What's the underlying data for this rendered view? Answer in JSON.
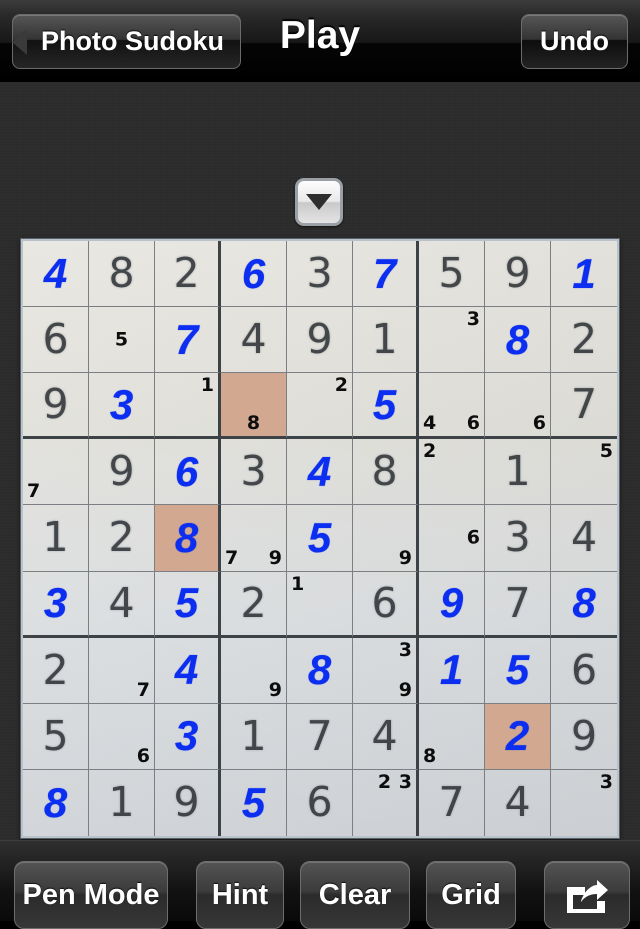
{
  "navbar": {
    "back_label": "Photo Sudoku",
    "title": "Play",
    "undo_label": "Undo"
  },
  "dropdown": {
    "icon": "chevron-down-icon"
  },
  "toolbar": {
    "pen_mode_label": "Pen Mode",
    "hint_label": "Hint",
    "clear_label": "Clear",
    "grid_label": "Grid",
    "share_icon": "share-arrow-icon"
  },
  "colors": {
    "user_entry": "#0b2ef0",
    "given_entry": "#2e3236",
    "highlight_cell": "#d2a890",
    "board_background": "#e3e2dc",
    "chrome": "#2b2b2b"
  },
  "board": {
    "rows": 9,
    "columns": 9,
    "cells": [
      [
        {
          "value": "4",
          "type": "user"
        },
        {
          "value": "8",
          "type": "given"
        },
        {
          "value": "2",
          "type": "given"
        },
        {
          "value": "6",
          "type": "user"
        },
        {
          "value": "3",
          "type": "given"
        },
        {
          "value": "7",
          "type": "user"
        },
        {
          "value": "5",
          "type": "given"
        },
        {
          "value": "9",
          "type": "given"
        },
        {
          "value": "1",
          "type": "user"
        }
      ],
      [
        {
          "value": "6",
          "type": "given"
        },
        {
          "value": "",
          "type": "empty",
          "marks": [
            {
              "text": "5",
              "pos": "mc"
            }
          ]
        },
        {
          "value": "7",
          "type": "user"
        },
        {
          "value": "4",
          "type": "given"
        },
        {
          "value": "9",
          "type": "given"
        },
        {
          "value": "1",
          "type": "given"
        },
        {
          "value": "",
          "type": "empty",
          "marks": [
            {
              "text": "3",
              "pos": "tr"
            }
          ]
        },
        {
          "value": "8",
          "type": "user"
        },
        {
          "value": "2",
          "type": "given"
        }
      ],
      [
        {
          "value": "9",
          "type": "given"
        },
        {
          "value": "3",
          "type": "user"
        },
        {
          "value": "",
          "type": "empty",
          "marks": [
            {
              "text": "1",
              "pos": "tr"
            }
          ]
        },
        {
          "value": "",
          "type": "empty",
          "highlight": true,
          "marks": [
            {
              "text": "8",
              "pos": "bc"
            }
          ]
        },
        {
          "value": "",
          "type": "empty",
          "marks": [
            {
              "text": "2",
              "pos": "tr"
            }
          ]
        },
        {
          "value": "5",
          "type": "user"
        },
        {
          "value": "",
          "type": "empty",
          "marks": [
            {
              "text": "4",
              "pos": "bl"
            },
            {
              "text": "6",
              "pos": "br"
            }
          ]
        },
        {
          "value": "",
          "type": "empty",
          "marks": [
            {
              "text": "6",
              "pos": "br"
            }
          ]
        },
        {
          "value": "7",
          "type": "given"
        }
      ],
      [
        {
          "value": "",
          "type": "empty",
          "marks": [
            {
              "text": "7",
              "pos": "bl"
            }
          ]
        },
        {
          "value": "9",
          "type": "given"
        },
        {
          "value": "6",
          "type": "user"
        },
        {
          "value": "3",
          "type": "given"
        },
        {
          "value": "4",
          "type": "user"
        },
        {
          "value": "8",
          "type": "given"
        },
        {
          "value": "",
          "type": "empty",
          "marks": [
            {
              "text": "2",
              "pos": "tl"
            }
          ]
        },
        {
          "value": "1",
          "type": "given"
        },
        {
          "value": "",
          "type": "empty",
          "marks": [
            {
              "text": "5",
              "pos": "tr"
            }
          ]
        }
      ],
      [
        {
          "value": "1",
          "type": "given"
        },
        {
          "value": "2",
          "type": "given"
        },
        {
          "value": "8",
          "type": "user",
          "highlight": true
        },
        {
          "value": "",
          "type": "empty",
          "marks": [
            {
              "text": "7",
              "pos": "bl"
            },
            {
              "text": "9",
              "pos": "br"
            }
          ]
        },
        {
          "value": "5",
          "type": "user"
        },
        {
          "value": "",
          "type": "empty",
          "marks": [
            {
              "text": "9",
              "pos": "br"
            }
          ]
        },
        {
          "value": "",
          "type": "empty",
          "marks": [
            {
              "text": "6",
              "pos": "mr"
            }
          ]
        },
        {
          "value": "3",
          "type": "given"
        },
        {
          "value": "4",
          "type": "given"
        }
      ],
      [
        {
          "value": "3",
          "type": "user"
        },
        {
          "value": "4",
          "type": "given"
        },
        {
          "value": "5",
          "type": "user"
        },
        {
          "value": "2",
          "type": "given"
        },
        {
          "value": "",
          "type": "empty",
          "marks": [
            {
              "text": "1",
              "pos": "tl"
            }
          ]
        },
        {
          "value": "6",
          "type": "given"
        },
        {
          "value": "9",
          "type": "user"
        },
        {
          "value": "7",
          "type": "given"
        },
        {
          "value": "8",
          "type": "user"
        }
      ],
      [
        {
          "value": "2",
          "type": "given"
        },
        {
          "value": "",
          "type": "empty",
          "marks": [
            {
              "text": "7",
              "pos": "br"
            }
          ]
        },
        {
          "value": "4",
          "type": "user"
        },
        {
          "value": "",
          "type": "empty",
          "marks": [
            {
              "text": "9",
              "pos": "br"
            }
          ]
        },
        {
          "value": "8",
          "type": "user"
        },
        {
          "value": "",
          "type": "empty",
          "marks": [
            {
              "text": "3",
              "pos": "tr"
            },
            {
              "text": "9",
              "pos": "br"
            }
          ]
        },
        {
          "value": "1",
          "type": "user"
        },
        {
          "value": "5",
          "type": "user"
        },
        {
          "value": "6",
          "type": "given"
        }
      ],
      [
        {
          "value": "5",
          "type": "given"
        },
        {
          "value": "",
          "type": "empty",
          "marks": [
            {
              "text": "6",
              "pos": "br"
            }
          ]
        },
        {
          "value": "3",
          "type": "user"
        },
        {
          "value": "1",
          "type": "given"
        },
        {
          "value": "7",
          "type": "given"
        },
        {
          "value": "4",
          "type": "given"
        },
        {
          "value": "",
          "type": "empty",
          "marks": [
            {
              "text": "8",
              "pos": "bl"
            }
          ]
        },
        {
          "value": "2",
          "type": "user",
          "highlight": true
        },
        {
          "value": "9",
          "type": "given"
        }
      ],
      [
        {
          "value": "8",
          "type": "user"
        },
        {
          "value": "1",
          "type": "given"
        },
        {
          "value": "9",
          "type": "given"
        },
        {
          "value": "5",
          "type": "user"
        },
        {
          "value": "6",
          "type": "given"
        },
        {
          "value": "",
          "type": "empty",
          "marks": [
            {
              "text": "2",
              "pos": "tc"
            },
            {
              "text": "3",
              "pos": "tr"
            }
          ]
        },
        {
          "value": "7",
          "type": "given"
        },
        {
          "value": "4",
          "type": "given"
        },
        {
          "value": "",
          "type": "empty",
          "marks": [
            {
              "text": "3",
              "pos": "tr"
            }
          ]
        }
      ]
    ]
  }
}
